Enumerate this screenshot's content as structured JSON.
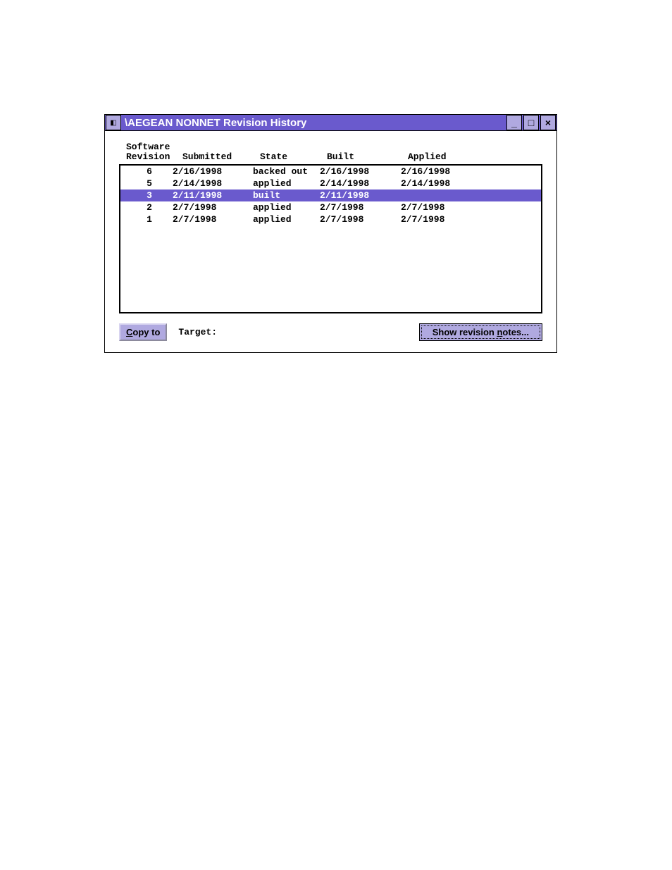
{
  "window": {
    "title": "\\AEGEAN NONNET Revision History"
  },
  "headers": {
    "revision_line1": "Software",
    "revision_line2": "Revision",
    "submitted": "Submitted",
    "state": "State",
    "built": "Built",
    "applied": "Applied"
  },
  "rows": [
    {
      "rev": "6",
      "submitted": "2/16/1998",
      "state": "backed out",
      "built": "2/16/1998",
      "applied": "2/16/1998",
      "selected": false
    },
    {
      "rev": "5",
      "submitted": "2/14/1998",
      "state": "applied",
      "built": "2/14/1998",
      "applied": "2/14/1998",
      "selected": false
    },
    {
      "rev": "3",
      "submitted": "2/11/1998",
      "state": "built",
      "built": "2/11/1998",
      "applied": "",
      "selected": true
    },
    {
      "rev": "2",
      "submitted": "2/7/1998",
      "state": "applied",
      "built": "2/7/1998",
      "applied": "2/7/1998",
      "selected": false
    },
    {
      "rev": "1",
      "submitted": "2/7/1998",
      "state": "applied",
      "built": "2/7/1998",
      "applied": "2/7/1998",
      "selected": false
    }
  ],
  "footer": {
    "copy_to_prefix": "C",
    "copy_to_rest": "opy to",
    "target_label": "Target:",
    "show_notes_prefix": "Show revision ",
    "show_notes_ul": "n",
    "show_notes_rest": "otes..."
  }
}
